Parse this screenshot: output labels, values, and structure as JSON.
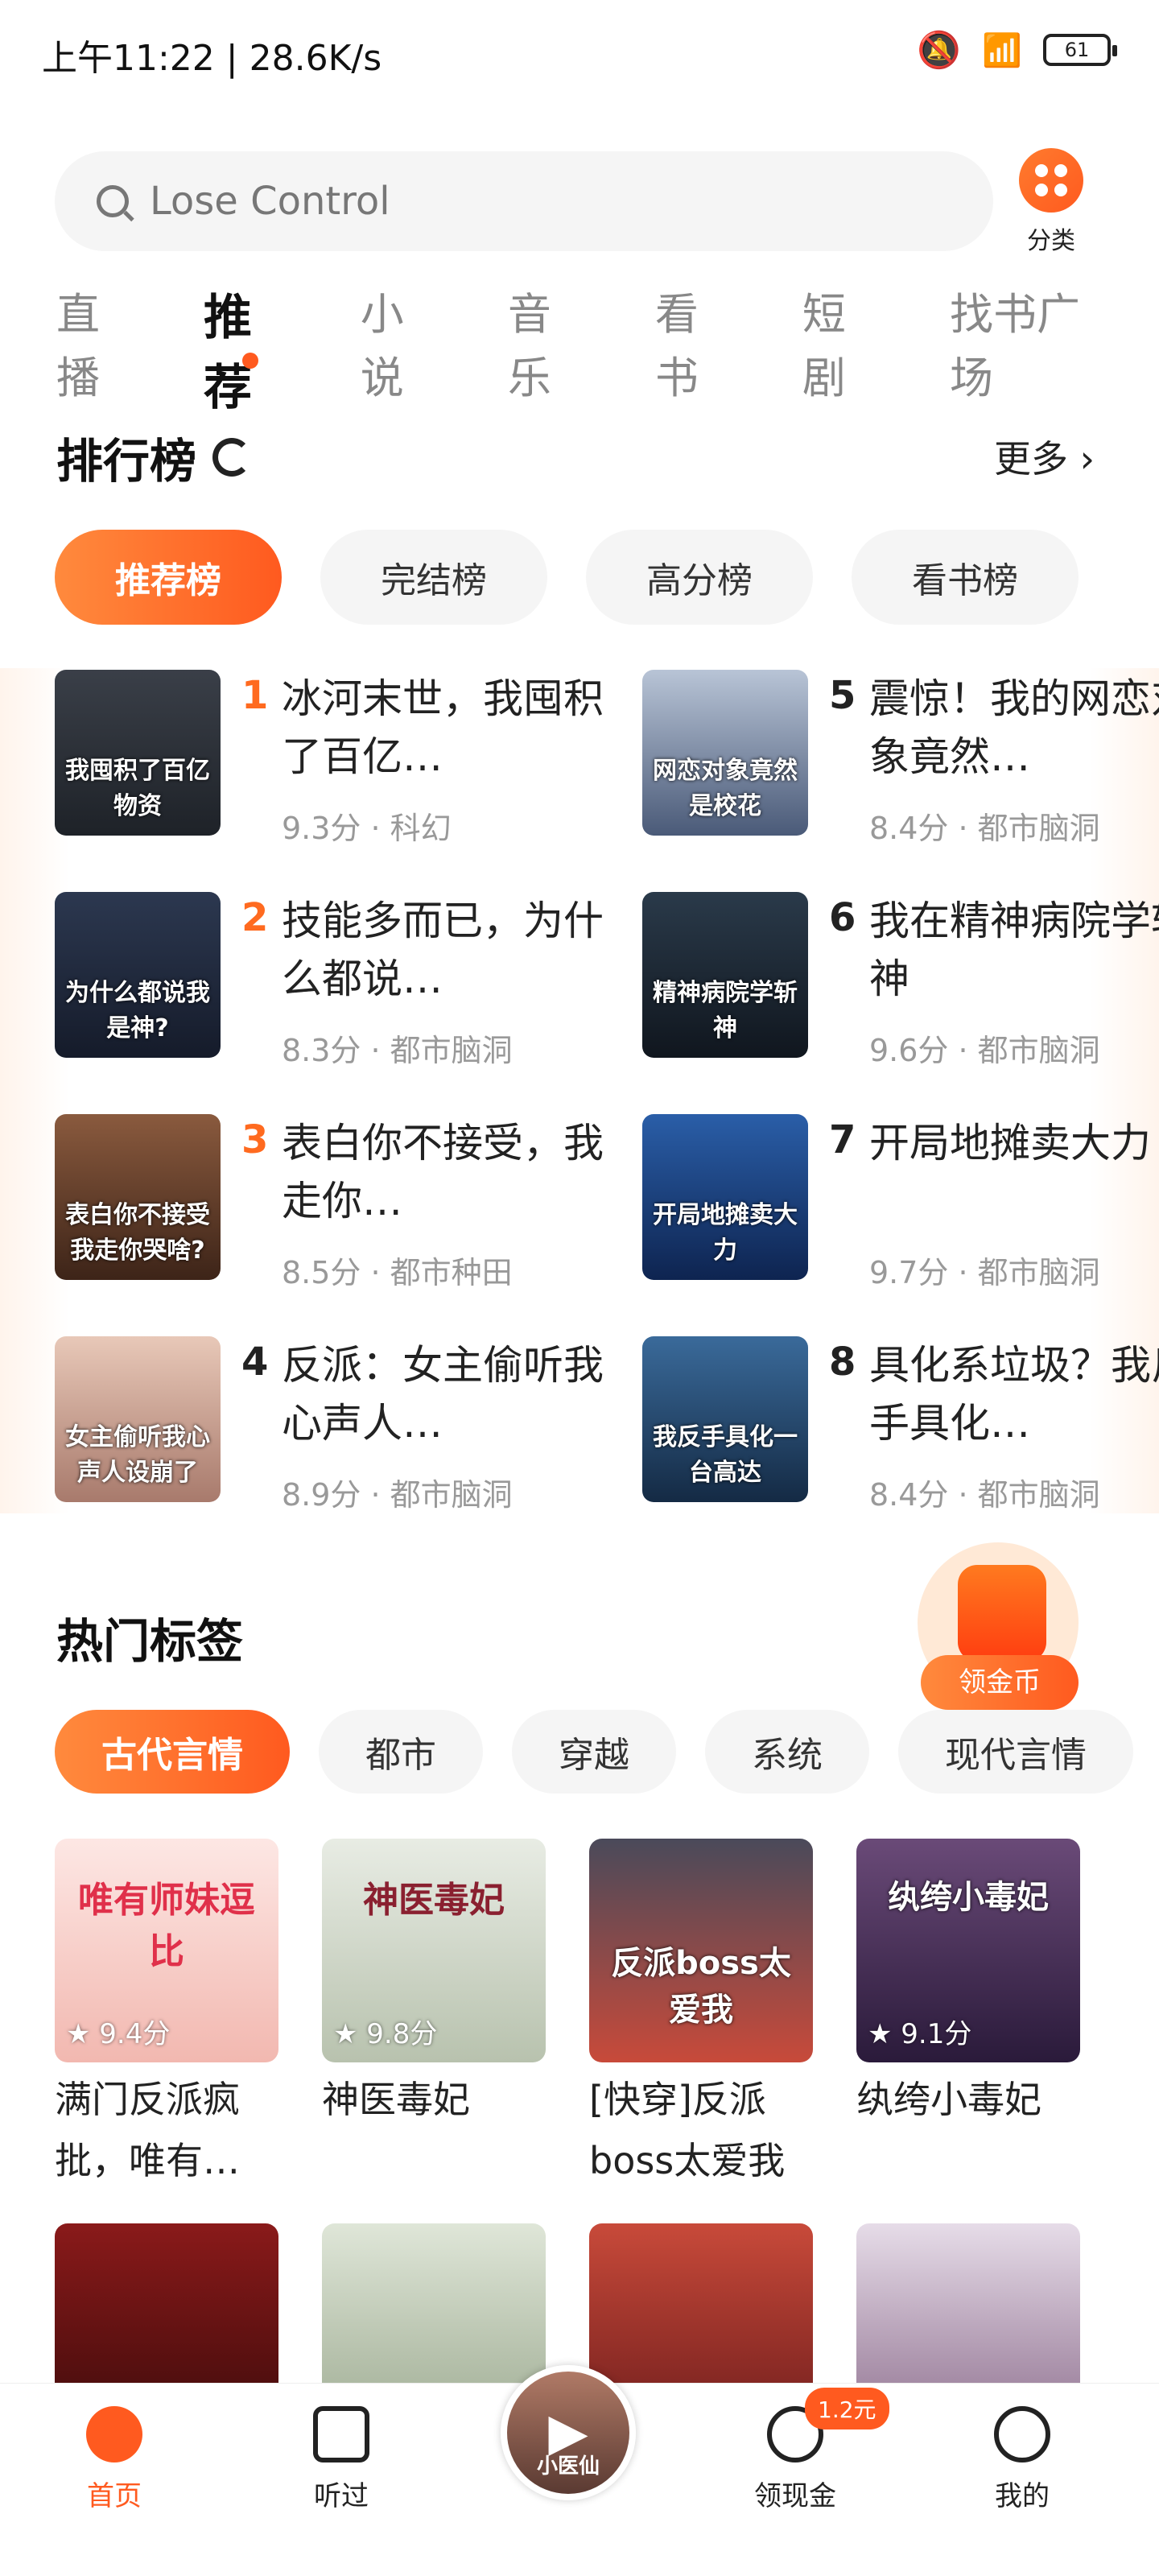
{
  "status_bar": {
    "time": "上午11:22 | 28.6K/s",
    "battery": "61"
  },
  "search": {
    "placeholder": "Lose Control"
  },
  "category": {
    "label": "分类"
  },
  "top_tabs": [
    "直播",
    "推荐",
    "小说",
    "音乐",
    "看书",
    "短剧",
    "找书广场"
  ],
  "ranking": {
    "title": "排行榜",
    "more": "更多 ›",
    "pills": [
      "推荐榜",
      "完结榜",
      "高分榜",
      "看书榜"
    ],
    "items": [
      {
        "rank": "1",
        "title": "冰河末世，我囤积了百亿…",
        "meta": "9.3分 · 科幻",
        "cover_text": "我囤积了百亿物资"
      },
      {
        "rank": "2",
        "title": "技能多而已，为什么都说…",
        "meta": "8.3分 · 都市脑洞",
        "cover_text": "为什么都说我是神?"
      },
      {
        "rank": "3",
        "title": "表白你不接受，我走你…",
        "meta": "8.5分 · 都市种田",
        "cover_text": "表白你不接受我走你哭啥?"
      },
      {
        "rank": "4",
        "title": "反派：女主偷听我心声人…",
        "meta": "8.9分 · 都市脑洞",
        "cover_text": "女主偷听我心声人设崩了"
      },
      {
        "rank": "5",
        "title": "震惊！我的网恋对象竟然…",
        "meta": "8.4分 · 都市脑洞",
        "cover_text": "网恋对象竟然是校花"
      },
      {
        "rank": "6",
        "title": "我在精神病院学斩神",
        "meta": "9.6分 · 都市脑洞",
        "cover_text": "精神病院学斩神"
      },
      {
        "rank": "7",
        "title": "开局地摊卖大力",
        "meta": "9.7分 · 都市脑洞",
        "cover_text": "开局地摊卖大力"
      },
      {
        "rank": "8",
        "title": "具化系垃圾？我反手具化…",
        "meta": "8.4分 · 都市脑洞",
        "cover_text": "我反手具化一台高达"
      }
    ]
  },
  "coin": {
    "label": "领金币"
  },
  "hot_tags": {
    "title": "热门标签",
    "tags": [
      "古代言情",
      "都市",
      "穿越",
      "系统",
      "现代言情"
    ],
    "books": [
      {
        "title": "满门反派疯批，唯有…",
        "score": "★ 9.4分",
        "cover_text": "唯有师妹逗比"
      },
      {
        "title": "神医毒妃",
        "score": "★ 9.8分",
        "cover_text": "神医毒妃"
      },
      {
        "title": "[快穿]反派boss太爱我",
        "score": "",
        "cover_text": "反派boss太爱我"
      },
      {
        "title": "纨绔小毒妃",
        "score": "★ 9.1分",
        "cover_text": "纨绔小毒妃"
      }
    ]
  },
  "bottom_nav": {
    "home": "首页",
    "listened": "听过",
    "cash": "领现金",
    "cash_badge": "1.2元",
    "me": "我的",
    "player_text": "小医仙"
  }
}
